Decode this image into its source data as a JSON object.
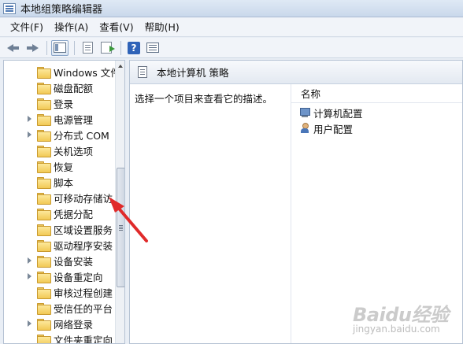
{
  "window": {
    "title": "本地组策略编辑器"
  },
  "menu": [
    {
      "label": "文件(F)"
    },
    {
      "label": "操作(A)"
    },
    {
      "label": "查看(V)"
    },
    {
      "label": "帮助(H)"
    }
  ],
  "tree": {
    "items": [
      {
        "label": "Windows 文件",
        "expandable": false
      },
      {
        "label": "磁盘配额",
        "expandable": false
      },
      {
        "label": "登录",
        "expandable": false
      },
      {
        "label": "电源管理",
        "expandable": true
      },
      {
        "label": "分布式 COM",
        "expandable": true
      },
      {
        "label": "关机选项",
        "expandable": false
      },
      {
        "label": "恢复",
        "expandable": false
      },
      {
        "label": "脚本",
        "expandable": false
      },
      {
        "label": "可移动存储访",
        "expandable": false
      },
      {
        "label": "凭据分配",
        "expandable": false
      },
      {
        "label": "区域设置服务",
        "expandable": false
      },
      {
        "label": "驱动程序安装",
        "expandable": false
      },
      {
        "label": "设备安装",
        "expandable": true
      },
      {
        "label": "设备重定向",
        "expandable": true
      },
      {
        "label": "审核过程创建",
        "expandable": false
      },
      {
        "label": "受信任的平台",
        "expandable": false
      },
      {
        "label": "网络登录",
        "expandable": true
      },
      {
        "label": "文件夹重定向",
        "expandable": false
      }
    ]
  },
  "detail": {
    "header_title": "本地计算机 策略",
    "description": "选择一个项目来查看它的描述。",
    "column_name": "名称",
    "items": [
      {
        "label": "计算机配置",
        "icon": "computer-config-icon"
      },
      {
        "label": "用户配置",
        "icon": "user-config-icon"
      }
    ]
  },
  "watermark": {
    "logo": "Baidu经验",
    "sub": "jingyan.baidu.com"
  }
}
